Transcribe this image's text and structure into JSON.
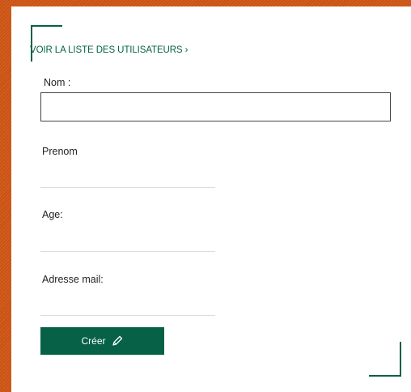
{
  "form": {
    "list_link": "VOIR LA LISTE DES UTILISATEURS ›",
    "nom_label": "Nom :",
    "nom_value": "",
    "prenom_label": "Prenom",
    "prenom_value": "",
    "age_label": "Age:",
    "age_value": "",
    "mail_label": "Adresse mail:",
    "mail_value": "",
    "submit_label": "Créer",
    "submit_icon": "pencil-icon"
  },
  "colors": {
    "background": "#d35716",
    "accent": "#066146",
    "panel": "#ffffff"
  }
}
